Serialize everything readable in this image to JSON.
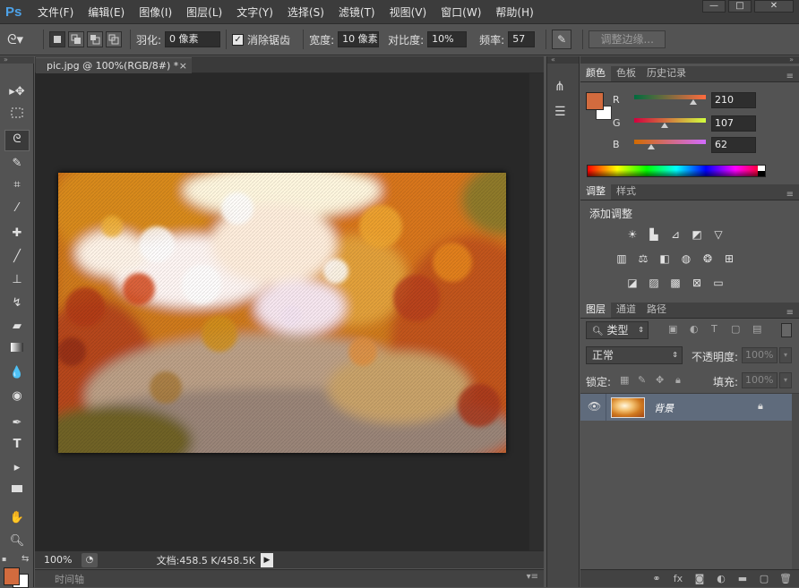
{
  "menubar": {
    "logo": "Ps",
    "items": [
      "文件(F)",
      "编辑(E)",
      "图像(I)",
      "图层(L)",
      "文字(Y)",
      "选择(S)",
      "滤镜(T)",
      "视图(V)",
      "窗口(W)",
      "帮助(H)"
    ],
    "window_buttons": [
      "—",
      "□",
      "✕"
    ]
  },
  "options": {
    "feather_label": "羽化:",
    "feather_value": "0 像素",
    "antialias_label": "消除锯齿",
    "width_label": "宽度:",
    "width_value": "10 像素",
    "contrast_label": "对比度:",
    "contrast_value": "10%",
    "frequency_label": "频率:",
    "frequency_value": "57",
    "refine_edge_label": "调整边缘..."
  },
  "document": {
    "tab_title": "pic.jpg @ 100%(RGB/8#) *",
    "tab_close": "×"
  },
  "status": {
    "zoom": "100%",
    "doc_info": "文档:458.5 K/458.5K"
  },
  "timeline": {
    "label": "时间轴"
  },
  "color_panel": {
    "tabs": [
      "颜色",
      "色板",
      "历史记录"
    ],
    "r_label": "R",
    "g_label": "G",
    "b_label": "B",
    "r": 210,
    "g": 107,
    "b": 62,
    "foreground_color": "#d26b3e",
    "background_color": "#ffffff"
  },
  "adjustments_panel": {
    "tabs": [
      "调整",
      "样式"
    ],
    "title": "添加调整"
  },
  "layers_panel": {
    "tabs": [
      "图层",
      "通道",
      "路径"
    ],
    "filter_kind": "类型",
    "blend_mode": "正常",
    "opacity_label": "不透明度:",
    "opacity_value": "100%",
    "lock_label": "锁定:",
    "fill_label": "填充:",
    "fill_value": "100%",
    "layers": [
      {
        "name": "背景",
        "visible": true,
        "locked": true
      }
    ]
  }
}
